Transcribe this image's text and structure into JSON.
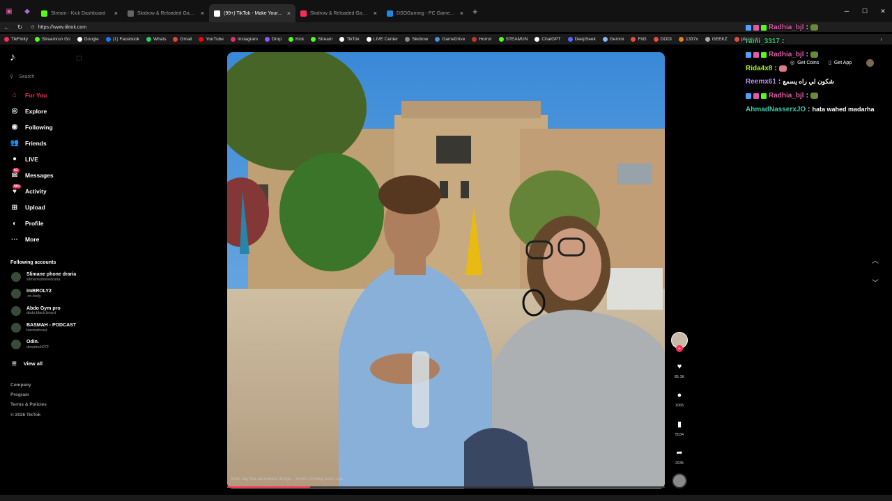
{
  "browser": {
    "tabs": [
      {
        "title": "Stream - Kick Dashboard",
        "active": false,
        "color": "#53fc18"
      },
      {
        "title": "Skidrow & Reloaded Games – Do...",
        "active": false,
        "color": "#666666"
      },
      {
        "title": "(99+) TikTok - Make Your Day",
        "active": true,
        "color": "#ffffff"
      },
      {
        "title": "Skidrow & Reloaded Games – Do...",
        "active": false,
        "color": "#fe2c55"
      },
      {
        "title": "DSOGaming - PC Games News, Sc...",
        "active": false,
        "color": "#1e88e5"
      }
    ],
    "new_tab": "+",
    "url": "https://www.tiktok.com",
    "bookmarks": [
      {
        "label": "TikFinity",
        "color": "#fe2c55"
      },
      {
        "label": "Streamrun Go",
        "color": "#53fc18"
      },
      {
        "label": "Google",
        "color": "#ffffff"
      },
      {
        "label": "(1) Facebook",
        "color": "#1877f2"
      },
      {
        "label": "Whats",
        "color": "#25d366"
      },
      {
        "label": "Gmail",
        "color": "#ea4335"
      },
      {
        "label": "YouTube",
        "color": "#ff0000"
      },
      {
        "label": "Instagram",
        "color": "#e1306c"
      },
      {
        "label": "Drop",
        "color": "#8a5cf6"
      },
      {
        "label": "Kick",
        "color": "#53fc18"
      },
      {
        "label": "Stream",
        "color": "#53fc18"
      },
      {
        "label": "TikTok",
        "color": "#ffffff"
      },
      {
        "label": "LIVE Center",
        "color": "#ffffff"
      },
      {
        "label": "Skidrow",
        "color": "#888888"
      },
      {
        "label": "GameDrive",
        "color": "#4a90e2"
      },
      {
        "label": "Horror",
        "color": "#c0392b"
      },
      {
        "label": "STEAMUN",
        "color": "#53fc18"
      },
      {
        "label": "ChatGPT",
        "color": "#ffffff"
      },
      {
        "label": "DeepSeek",
        "color": "#4d6bfe"
      },
      {
        "label": "Gemini",
        "color": "#8ab4f8"
      },
      {
        "label": "FitG",
        "color": "#e74c3c"
      },
      {
        "label": "DODI",
        "color": "#e74c3c"
      },
      {
        "label": "1337x",
        "color": "#e67e22"
      },
      {
        "label": "GEEKZ",
        "color": "#aaaaaa"
      },
      {
        "label": "player.gg",
        "color": "#e74c3c"
      }
    ]
  },
  "sidebar": {
    "search_placeholder": "Search",
    "nav": [
      {
        "label": "For You",
        "icon": "home-icon",
        "glyph": "⌂",
        "active": true
      },
      {
        "label": "Explore",
        "icon": "compass-icon",
        "glyph": "◎",
        "active": false
      },
      {
        "label": "Following",
        "icon": "following-icon",
        "glyph": "◉",
        "active": false
      },
      {
        "label": "Friends",
        "icon": "friends-icon",
        "glyph": "👥",
        "active": false
      },
      {
        "label": "LIVE",
        "icon": "live-icon",
        "glyph": "●",
        "active": false
      },
      {
        "label": "Messages",
        "icon": "messages-icon",
        "glyph": "✉",
        "active": false,
        "badge": "92"
      },
      {
        "label": "Activity",
        "icon": "activity-icon",
        "glyph": "♥",
        "active": false,
        "badge": "99+"
      },
      {
        "label": "Upload",
        "icon": "upload-icon",
        "glyph": "⊞",
        "active": false
      },
      {
        "label": "Profile",
        "icon": "profile-icon",
        "glyph": "◐",
        "active": false
      },
      {
        "label": "More",
        "icon": "more-icon",
        "glyph": "···",
        "active": false
      }
    ],
    "following_title": "Following accounts",
    "accounts": [
      {
        "name": "Slimane phone draria",
        "handle": "slimanephonedraria"
      },
      {
        "name": "ImBROLY2",
        "handle": ".im.broly"
      },
      {
        "name": "Abdo Gym pro",
        "handle": "abdo.black.beard"
      },
      {
        "name": "BASMAH - PODCAST",
        "handle": "basmahcast"
      },
      {
        "name": "Odin.",
        "handle": "deeptech072"
      }
    ],
    "view_all": "View all",
    "footer": [
      "Company",
      "Program",
      "Terms & Policies",
      "© 2026 TikTok"
    ]
  },
  "video": {
    "caption": "Kids say the darnedest things... series coming soon sus",
    "progress": 0.19
  },
  "actions": {
    "likes": "85.1K",
    "comments": "1066",
    "saves": "5534",
    "shares": "2935"
  },
  "header_buttons": {
    "get_coins": "Get Coins",
    "get_app": "Get App"
  },
  "chat": [
    {
      "user": "Radhia_bjl",
      "sep": " :",
      "message": "",
      "color": "#e05aa8",
      "badges": true,
      "emote": "#6a8a3a"
    },
    {
      "user": "rami_3317",
      "sep": " :",
      "message": "",
      "color": "#3fc870",
      "badges": false,
      "emote": ""
    },
    {
      "user": "Radhia_bjl",
      "sep": " :",
      "message": "",
      "color": "#e05aa8",
      "badges": true,
      "emote": "#6a8a3a"
    },
    {
      "user": "Rida4x8",
      "sep": " :",
      "message": "",
      "color": "#a6f02a",
      "badges": false,
      "emote": "#e07a8a"
    },
    {
      "user": "Reemx61",
      "sep": " :",
      "message": "شكون لي راه يسمع",
      "color": "#b98cf0",
      "badges": false,
      "emote": ""
    },
    {
      "user": "Radhia_bjl",
      "sep": " :",
      "message": "",
      "color": "#e05aa8",
      "badges": true,
      "emote": "#6a8a3a"
    },
    {
      "user": "AhmadNasserxJO",
      "sep": " :",
      "message": "hata wahed madarha",
      "color": "#43c6a8",
      "badges": false,
      "emote": ""
    }
  ]
}
